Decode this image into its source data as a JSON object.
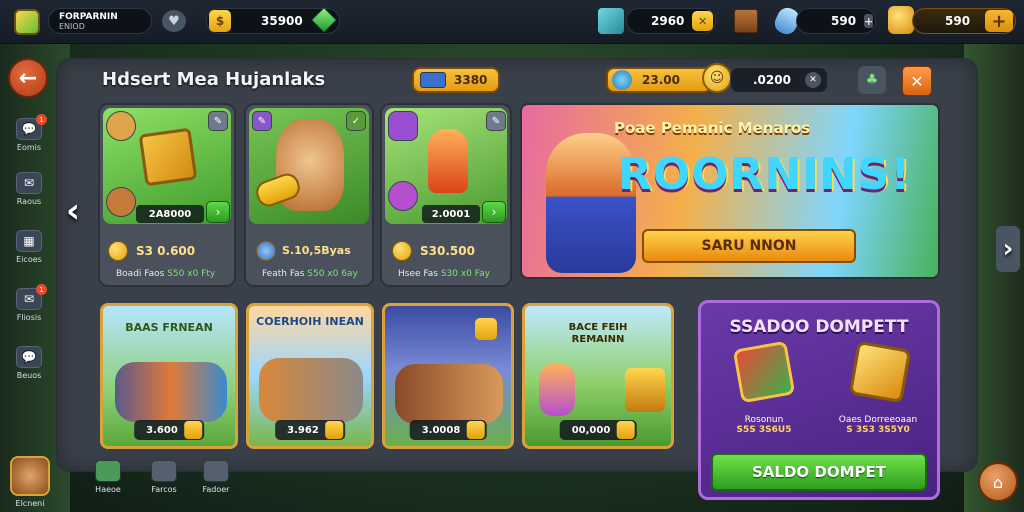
{
  "topbar": {
    "profile_name_line1": "FORPARNIN",
    "profile_name_line2": "ENIOD",
    "coins": "35900",
    "resource_a": "2960",
    "resource_b": "590",
    "resource_c": "590"
  },
  "sidebar": {
    "items": [
      {
        "label": "Eomis",
        "icon": "chat-icon",
        "badge": "1"
      },
      {
        "label": "Raous",
        "icon": "mail-icon",
        "badge": ""
      },
      {
        "label": "Eicoes",
        "icon": "board-icon",
        "badge": ""
      },
      {
        "label": "Fliosis",
        "icon": "mail-icon",
        "badge": "1"
      },
      {
        "label": "Beuos",
        "icon": "chat-icon",
        "badge": ""
      }
    ]
  },
  "panel": {
    "title": "Hdsert Mea Hujanlaks",
    "currency_pill": "3380",
    "currency_pill2": "23.00",
    "currency_pill3": ".0200"
  },
  "top_cards": [
    {
      "art_label": "2A8000",
      "price": "S3 0.600",
      "sub": "Boadi Faos",
      "sub_green": "S50 x0 Fty"
    },
    {
      "art_label": "",
      "price": "S.10,5Byas",
      "sub": "Feath Fas",
      "sub_green": "S50 x0 6ay"
    },
    {
      "art_label": "2.0001",
      "price": "S30.500",
      "sub": "Hsee Fas",
      "sub_green": "S30 x0 Fay"
    }
  ],
  "banner": {
    "headline": "Poae Pemanic Menaros",
    "big_text": "ROORNINS!",
    "button": "SARU NNON"
  },
  "bottom_cards": [
    {
      "title": "BAAS FRNEAN",
      "price": "3.600"
    },
    {
      "title": "COERHOIH INEAN",
      "price": "3.962"
    },
    {
      "title": "",
      "price": "3.0008"
    },
    {
      "title": "BACE FEIH REMAINN",
      "price": "00,000"
    }
  ],
  "promo": {
    "title": "SSADOO DOMPETT",
    "item1_name": "Rosonun",
    "item1_price": "S5S 3S6U5",
    "item2_name": "Oaes Dorreeoaan",
    "item2_price": "S 3S3 3S5Y0",
    "button": "SALDO DOMPET"
  },
  "bottom_nav": [
    {
      "label": "Elcneni",
      "icon": "pet-icon"
    },
    {
      "label": "Haeoe",
      "icon": "gift-icon"
    },
    {
      "label": "Farcos",
      "icon": "card-icon"
    },
    {
      "label": "Fadoer",
      "icon": "box-icon"
    }
  ]
}
